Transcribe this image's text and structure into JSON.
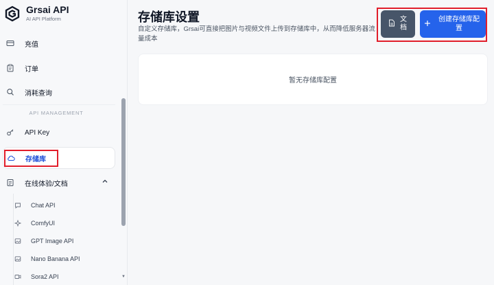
{
  "brand": {
    "name": "Grsai API",
    "subtitle": "AI API Platform"
  },
  "sidebar": {
    "top_items": [
      {
        "label": "充值",
        "icon": "wallet-icon"
      },
      {
        "label": "订单",
        "icon": "clipboard-icon"
      },
      {
        "label": "消耗查询",
        "icon": "search-icon"
      }
    ],
    "section_label": "API MANAGEMENT",
    "mgmt_items": [
      {
        "label": "API Key",
        "icon": "key-icon"
      },
      {
        "label": "存储库",
        "icon": "cloud-icon",
        "active": true
      },
      {
        "label": "在线体验/文档",
        "icon": "document-icon",
        "expanded": true
      }
    ],
    "sub_items": [
      {
        "label": "Chat API",
        "icon": "chat-icon"
      },
      {
        "label": "ComfyUI",
        "icon": "sparkle-icon"
      },
      {
        "label": "GPT Image API",
        "icon": "image-icon"
      },
      {
        "label": "Nano Banana API",
        "icon": "image-icon"
      },
      {
        "label": "Sora2 API",
        "icon": "video-icon"
      }
    ]
  },
  "main": {
    "title": "存储库设置",
    "description": "自定义存储库，Grsai可直接把图片与视频文件上传到存储库中，从而降低服务器流量成本",
    "doc_button": "文档",
    "create_button": "创建存储库配置",
    "empty_text": "暂无存储库配置"
  },
  "colors": {
    "accent": "#2563eb",
    "doc_button": "#475569",
    "highlight": "#e11d2a"
  }
}
